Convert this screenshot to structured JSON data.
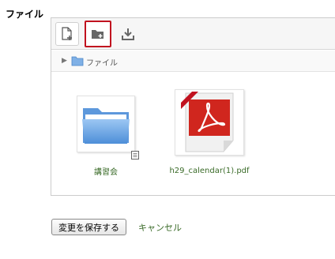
{
  "field": {
    "label": "ファイル"
  },
  "toolbar": {
    "add_file_icon": "add-file-icon",
    "add_folder_icon": "add-folder-icon",
    "download_icon": "download-icon",
    "highlight_color": "#c1121f"
  },
  "path": {
    "current": "ファイル"
  },
  "files": [
    {
      "name": "講習会",
      "type": "folder"
    },
    {
      "name": "h29_calendar(1).pdf",
      "type": "pdf"
    }
  ],
  "actions": {
    "save_label": "変更を保存する",
    "cancel_label": "キャンセル"
  },
  "colors": {
    "link": "#3a6b28",
    "pdf_red": "#d0261e",
    "folder_blue": "#6aa7e8"
  }
}
